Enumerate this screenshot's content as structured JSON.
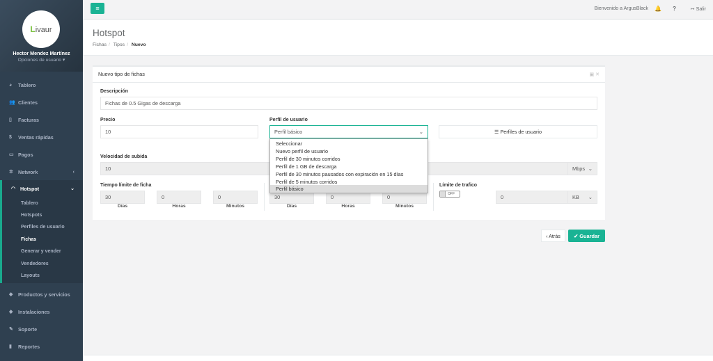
{
  "sidebar": {
    "logo_text": "Livaur",
    "user_name": "Hector Mendez Martínez",
    "user_options": "Opciones de usuario ▾",
    "items": [
      {
        "label": "Tablero"
      },
      {
        "label": "Clientes"
      },
      {
        "label": "Facturas"
      },
      {
        "label": "Ventas rápidas"
      },
      {
        "label": "Pagos"
      },
      {
        "label": "Network"
      },
      {
        "label": "Hotspot"
      },
      {
        "label": "Productos y servicios"
      },
      {
        "label": "Instalaciones"
      },
      {
        "label": "Soporte"
      },
      {
        "label": "Reportes"
      }
    ],
    "submenu": [
      {
        "label": "Tablero"
      },
      {
        "label": "Hotspots"
      },
      {
        "label": "Perfiles de usuario"
      },
      {
        "label": "Fichas"
      },
      {
        "label": "Generar y vender"
      },
      {
        "label": "Vendedores"
      },
      {
        "label": "Layouts"
      }
    ]
  },
  "topbar": {
    "welcome": "Bienvenido a ArgusBlack",
    "logout": "Salir"
  },
  "heading": {
    "title": "Hotspot",
    "crumbs": [
      "Fichas",
      "Tipos",
      "Nuevo"
    ]
  },
  "form": {
    "panel_title": "Nuevo tipo de fichas",
    "descripcion_label": "Descripción",
    "descripcion_value": "Fichas de 0.5 Gigas de descarga",
    "precio_label": "Precio",
    "precio_value": "10",
    "perfil_label": "Perfil de usuario",
    "perfil_value": "Perfil básico",
    "perfiles_button": "Perfiles de usuario",
    "subida_label": "Velocidad de subida",
    "subida_value": "10",
    "subida_unit": "Mbps",
    "tiempo_label": "Tiempo límite de ficha",
    "t_dias": "30",
    "t_horas": "0",
    "t_minutos": "0",
    "t2_dias": "30",
    "t2_horas": "0",
    "t2_minutos": "0",
    "dias_label": "Días",
    "horas_label": "Horas",
    "minutos_label": "Minutos",
    "limite_label": "Límite de trafico",
    "toggle_label": "OFF",
    "limite_value": "0",
    "limite_unit": "KB"
  },
  "dropdown": {
    "options": [
      "Seleccionar",
      "Nuevo perfil de usuario",
      "Perfil de 30 minutos corridos",
      "Perfil de 1 GB de descarga",
      "Perfil de 30 minutos pausados con expiración en 15 días",
      "Perfil de 5 minutos corridos",
      "Perfil básico"
    ],
    "selected": "Perfil básico"
  },
  "actions": {
    "back": "‹ Atrás",
    "save": "Guardar"
  },
  "colors": {
    "accent": "#1ab394",
    "sidebar": "#2f4050"
  }
}
